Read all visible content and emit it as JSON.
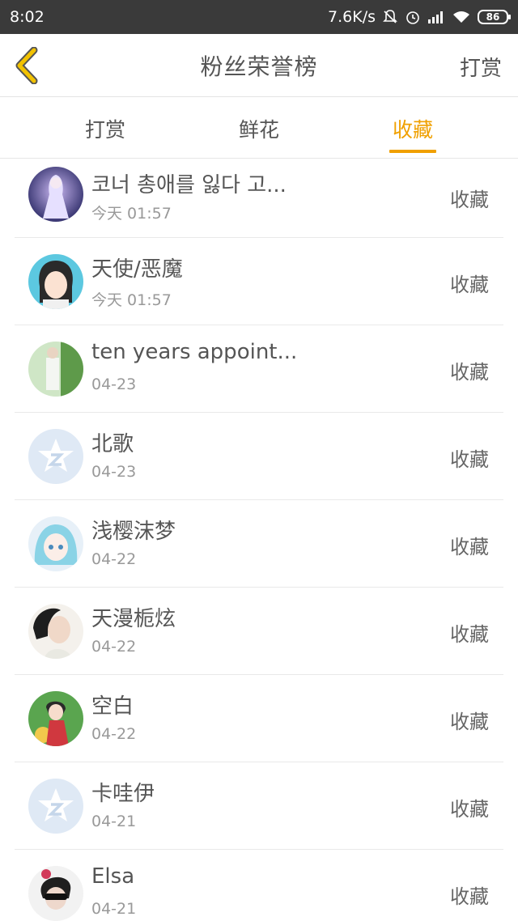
{
  "status_bar": {
    "time": "8:02",
    "net_speed": "7.6K/s",
    "battery": "86",
    "icons": [
      "mute-bell-icon",
      "alarm-icon",
      "signal-icon",
      "wifi-icon",
      "battery-icon"
    ]
  },
  "header": {
    "title": "粉丝荣誉榜",
    "action_label": "打赏",
    "back_icon": "chevron-left-icon"
  },
  "tabs": [
    {
      "label": "打赏"
    },
    {
      "label": "鲜花"
    },
    {
      "label": "收藏"
    }
  ],
  "active_tab": "收藏",
  "accent_color": "#f0a000",
  "list": [
    {
      "name": "코너 총애를 잃다 고...",
      "date": "今天 01:57",
      "action": "收藏",
      "avatar": "anime-girl-avatar"
    },
    {
      "name": "天使/恶魔",
      "date": "今天 01:57",
      "action": "收藏",
      "avatar": "cartoon-girl-avatar"
    },
    {
      "name": "ten years appoint...",
      "date": "04-23",
      "action": "收藏",
      "avatar": "photo-avatar"
    },
    {
      "name": "北歌",
      "date": "04-23",
      "action": "收藏",
      "avatar": "default-z-avatar"
    },
    {
      "name": "浅樱沫梦",
      "date": "04-22",
      "action": "收藏",
      "avatar": "anime-blue-hair-avatar"
    },
    {
      "name": "天漫栀炫",
      "date": "04-22",
      "action": "收藏",
      "avatar": "photo-girl-avatar"
    },
    {
      "name": "空白",
      "date": "04-22",
      "action": "收藏",
      "avatar": "anime-red-avatar"
    },
    {
      "name": "卡哇伊",
      "date": "04-21",
      "action": "收藏",
      "avatar": "default-z-avatar"
    },
    {
      "name": "Elsa",
      "date": "04-21",
      "action": "收藏",
      "avatar": "sunglasses-girl-avatar"
    }
  ]
}
